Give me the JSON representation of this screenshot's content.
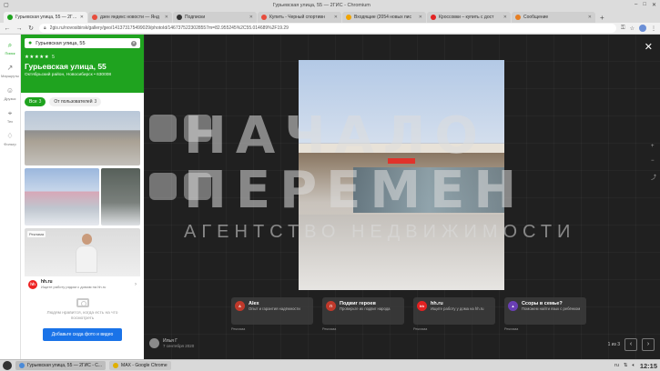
{
  "window": {
    "title": "Гурьевская улица, 55 — 2ГИС - Chromium",
    "controls": [
      "–",
      "□",
      "✕"
    ]
  },
  "tabs": [
    {
      "label": "Гурьевская улица, 55 — 2ГИС",
      "color": "#1fa31f",
      "active": true
    },
    {
      "label": "дзен яндекс новости — Янд",
      "color": "#e74c3c"
    },
    {
      "label": "Подписки",
      "color": "#333333"
    },
    {
      "label": "Купить - Черный спортивн",
      "color": "#e74c3c"
    },
    {
      "label": "Входящие (2054 новых пис",
      "color": "#f1a400"
    },
    {
      "label": "Кроссовки – купить с дост",
      "color": "#e22222"
    },
    {
      "label": "Сообщение",
      "color": "#e67e22"
    }
  ],
  "address": {
    "url": "2gis.ru/novosibirsk/gallery/geo/141373175499029/photoId/1467375223028557m=82.955245%2C55.014689%2F19.29"
  },
  "leftnav": [
    {
      "label": "Поиск",
      "icon": "search-icon",
      "glyph": "⌕",
      "active": true
    },
    {
      "label": "Маршруты",
      "icon": "route-icon",
      "glyph": "↗"
    },
    {
      "label": "Друзья",
      "icon": "friends-icon",
      "glyph": "☺"
    },
    {
      "label": "Тех",
      "icon": "pin-icon",
      "glyph": "⌖"
    },
    {
      "label": "Фильтр",
      "icon": "filter-icon",
      "glyph": "♢"
    }
  ],
  "place": {
    "search_query": "Гурьевская улица, 55",
    "stars": "★★★★★",
    "rating": "5",
    "name": "Гурьевская улица, 55",
    "address": "Октябрьский район, Новосибирск • 630008",
    "filters": [
      {
        "label": "Все",
        "count": "3",
        "active": true
      },
      {
        "label": "От пользователей",
        "count": "3"
      }
    ],
    "ad": {
      "tag": "Реклама",
      "brand_logo": "hh",
      "brand": "hh.ru",
      "text": "Ищите работу рядом с домом на hh.ru"
    },
    "empty_message": "Людям нравится, когда есть на что посмотреть",
    "add_button": "Добавьте сюда фото и видео"
  },
  "viewer": {
    "watermark": {
      "line1": "НАЧАЛО",
      "line2": "ПЕРЕМЕН",
      "line3": "АГЕНТСТВО НЕДВИЖИМОСТИ"
    },
    "ads": [
      {
        "title": "Alex",
        "subtitle": "Опыт и гарантия надёжности",
        "label": "Реклама",
        "logo": "A",
        "color": "#c0392b"
      },
      {
        "title": "Подвиг героев",
        "subtitle": "Проверьте их подвиг народа",
        "label": "Реклама",
        "logo": "П",
        "color": "#c0392b"
      },
      {
        "title": "hh.ru",
        "subtitle": "Ищите работу у дома на hh.ru",
        "label": "Реклама",
        "logo": "hh",
        "color": "#e22222"
      },
      {
        "title": "Ссоры в семье?",
        "subtitle": "Поможем найти язык с ребёнком",
        "label": "Реклама",
        "logo": "▲",
        "color": "#6a3fb5"
      }
    ],
    "author": {
      "name": "Илья Г",
      "date": "7 сентября 2020"
    },
    "counter": "1 из 3"
  },
  "taskbar": {
    "items": [
      {
        "label": "Гурьевская улица, 55 — 2ГИС - C...",
        "color": "#4a8ad8",
        "active": true
      },
      {
        "label": "MAX - Google Chrome",
        "color": "#e0b000"
      }
    ],
    "lang": "ru",
    "clock": "12:15"
  }
}
